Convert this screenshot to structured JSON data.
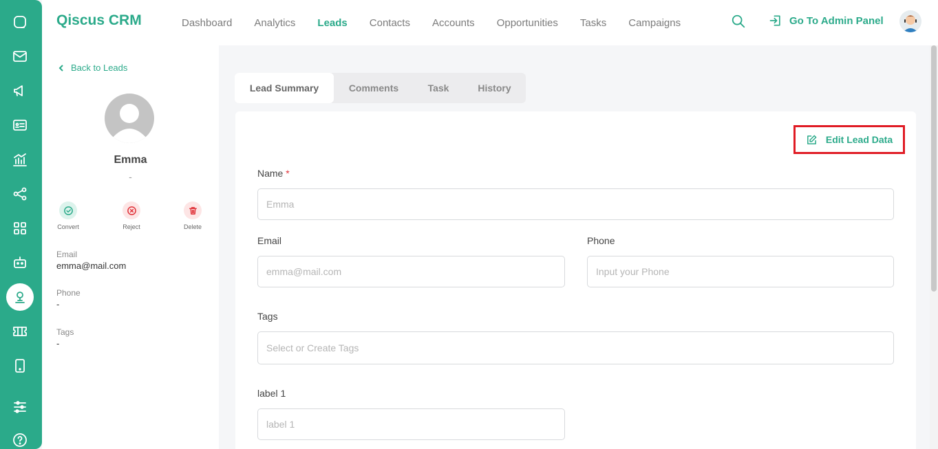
{
  "app": {
    "brand": "Qiscus CRM"
  },
  "nav": {
    "items": [
      {
        "label": "Dashboard",
        "active": false
      },
      {
        "label": "Analytics",
        "active": false
      },
      {
        "label": "Leads",
        "active": true
      },
      {
        "label": "Contacts",
        "active": false
      },
      {
        "label": "Accounts",
        "active": false
      },
      {
        "label": "Opportunities",
        "active": false
      },
      {
        "label": "Tasks",
        "active": false
      },
      {
        "label": "Campaigns",
        "active": false
      }
    ],
    "admin_label": "Go To Admin Panel"
  },
  "rail": {
    "icons": [
      "chat-icon",
      "mail-icon",
      "megaphone-icon",
      "contact-card-icon",
      "analytics-icon",
      "share-icon",
      "grid-icon",
      "robot-icon",
      "leads-icon",
      "ticket-icon",
      "mobile-icon",
      "settings-sliders-icon",
      "help-icon"
    ],
    "active": "leads-icon"
  },
  "profile": {
    "back_label": "Back to Leads",
    "name": "Emma",
    "subtitle": "-",
    "actions": [
      {
        "label": "Convert",
        "icon": "check-circle-icon",
        "color": "#2baa8a"
      },
      {
        "label": "Reject",
        "icon": "x-circle-icon",
        "color": "#e0333a"
      },
      {
        "label": "Delete",
        "icon": "trash-icon",
        "color": "#e0333a"
      }
    ],
    "fields": [
      {
        "label": "Email",
        "value": "emma@mail.com"
      },
      {
        "label": "Phone",
        "value": "-"
      },
      {
        "label": "Tags",
        "value": "-"
      }
    ]
  },
  "tabs": [
    {
      "label": "Lead Summary",
      "active": true
    },
    {
      "label": "Comments",
      "active": false
    },
    {
      "label": "Task",
      "active": false
    },
    {
      "label": "History",
      "active": false
    }
  ],
  "form": {
    "edit_label": "Edit Lead Data",
    "name_label": "Name",
    "name_required": "*",
    "name_placeholder": "Emma",
    "email_label": "Email",
    "email_placeholder": "emma@mail.com",
    "phone_label": "Phone",
    "phone_placeholder": "Input your Phone",
    "tags_label": "Tags",
    "tags_placeholder": "Select or Create Tags",
    "label1_label": "label 1",
    "label1_placeholder": "label 1"
  },
  "colors": {
    "accent": "#2baa8a",
    "danger": "#e0333a",
    "highlight": "#e01b24"
  }
}
